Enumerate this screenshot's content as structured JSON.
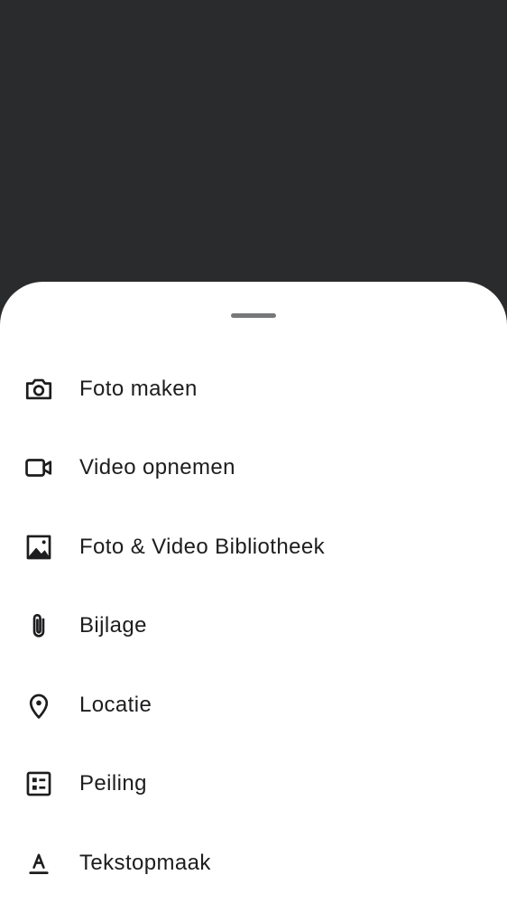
{
  "sheet": {
    "items": [
      {
        "label": "Foto maken",
        "icon": "camera-icon"
      },
      {
        "label": "Video opnemen",
        "icon": "videocam-icon"
      },
      {
        "label": "Foto & Video Bibliotheek",
        "icon": "image-icon"
      },
      {
        "label": "Bijlage",
        "icon": "paperclip-icon"
      },
      {
        "label": "Locatie",
        "icon": "location-pin-icon"
      },
      {
        "label": "Peiling",
        "icon": "poll-icon"
      },
      {
        "label": "Tekstopmaak",
        "icon": "text-format-icon"
      }
    ]
  },
  "colors": {
    "backdrop": "#2a2b2d",
    "sheet": "#ffffff",
    "text": "#1d1d1f",
    "handle": "#77787a"
  }
}
